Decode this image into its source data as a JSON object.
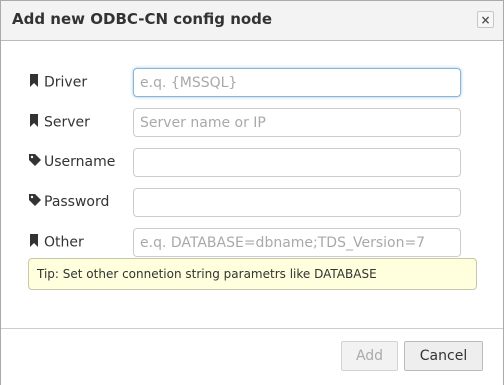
{
  "dialog": {
    "title": "Add new ODBC-CN config node",
    "close_symbol": "×"
  },
  "fields": [
    {
      "label": "Driver",
      "icon": "bookmark-icon",
      "value": "",
      "placeholder": "e.q. {MSSQL}"
    },
    {
      "label": "Server",
      "icon": "bookmark-icon",
      "value": "",
      "placeholder": "Server name or IP"
    },
    {
      "label": "Username",
      "icon": "tag-icon",
      "value": "",
      "placeholder": ""
    },
    {
      "label": "Password",
      "icon": "tag-icon",
      "value": "",
      "placeholder": ""
    },
    {
      "label": "Other",
      "icon": "bookmark-icon",
      "value": "",
      "placeholder": "e.q. DATABASE=dbname;TDS_Version=7"
    }
  ],
  "tip": "Tip: Set other connetion string parametrs like DATABASE",
  "buttons": {
    "add": "Add",
    "cancel": "Cancel"
  },
  "colors": {
    "titlebar_bg": "#f3f3f3",
    "tip_bg": "#ffffdd",
    "focus_border": "#85b7dc"
  }
}
